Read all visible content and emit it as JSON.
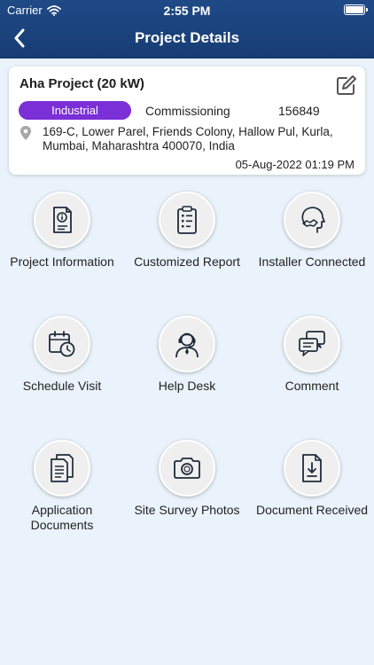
{
  "status_bar": {
    "carrier": "Carrier",
    "time": "2:55 PM"
  },
  "nav": {
    "title": "Project Details"
  },
  "project": {
    "title": "Aha Project (20 kW)",
    "category": "Industrial",
    "category_color": "#7b2fd6",
    "stage": "Commissioning",
    "id": "156849",
    "address": "169-C, Lower Parel, Friends Colony, Hallow Pul, Kurla, Mumbai, Maharashtra 400070, India",
    "date": "05-Aug-2022 01:19 PM"
  },
  "tiles": [
    {
      "label": "Project Information",
      "icon": "project-info-icon"
    },
    {
      "label": "Customized Report",
      "icon": "report-clipboard-icon"
    },
    {
      "label": "Installer Connected",
      "icon": "handshake-head-icon"
    },
    {
      "label": "Schedule Visit",
      "icon": "calendar-clock-icon"
    },
    {
      "label": "Help Desk",
      "icon": "support-agent-icon"
    },
    {
      "label": "Comment",
      "icon": "chat-bubbles-icon"
    },
    {
      "label": "Application Documents",
      "icon": "documents-icon"
    },
    {
      "label": "Site Survey Photos",
      "icon": "camera-icon"
    },
    {
      "label": "Document Received",
      "icon": "document-download-icon"
    }
  ],
  "colors": {
    "header": "#1f4a86",
    "background": "#eaf3fb",
    "icon_stroke": "#1e2a3a"
  }
}
